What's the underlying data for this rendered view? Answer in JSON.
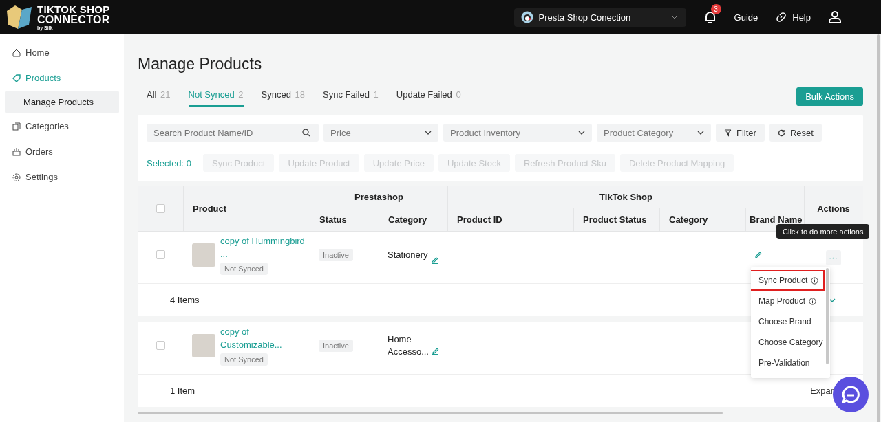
{
  "header": {
    "logo_line1": "TIKTOK SHOP",
    "logo_line2": "CONNECTOR",
    "logo_by": "by Silk",
    "shop_select": "Presta Shop Conection",
    "notifications": "3",
    "guide": "Guide",
    "help": "Help"
  },
  "sidebar": {
    "items": [
      {
        "label": "Home",
        "selected": false
      },
      {
        "label": "Products",
        "selected": true,
        "children": [
          {
            "label": "Manage Products",
            "selected": true
          }
        ]
      },
      {
        "label": "Categories",
        "selected": false
      },
      {
        "label": "Orders",
        "selected": false
      },
      {
        "label": "Settings",
        "selected": false
      }
    ]
  },
  "page": {
    "title": "Manage Products",
    "bulk_actions": "Bulk Actions"
  },
  "tabs": [
    {
      "label": "All",
      "count": "21",
      "selected": false
    },
    {
      "label": "Not Synced",
      "count": "2",
      "selected": true
    },
    {
      "label": "Synced",
      "count": "18",
      "selected": false
    },
    {
      "label": "Sync Failed",
      "count": "1",
      "selected": false
    },
    {
      "label": "Update Failed",
      "count": "0",
      "selected": false
    }
  ],
  "filters": {
    "search": {
      "placeholder": "Search Product Name/ID"
    },
    "selects": [
      {
        "placeholder": "Price"
      },
      {
        "placeholder": "Product Inventory"
      },
      {
        "placeholder": "Product Category"
      }
    ],
    "filter": "Filter",
    "reset": "Reset"
  },
  "bulk": {
    "selected": "Selected: 0",
    "buttons": [
      {
        "label": "Sync Product",
        "disabled": true
      },
      {
        "label": "Update Product",
        "disabled": true
      },
      {
        "label": "Update Price",
        "disabled": true
      },
      {
        "label": "Update Stock",
        "disabled": true
      },
      {
        "label": "Refresh Product Sku",
        "disabled": true
      },
      {
        "label": "Delete Product Mapping",
        "disabled": true
      }
    ]
  },
  "table": {
    "header_checked": false,
    "group_prestashop": "Prestashop",
    "group_tiktok": "TikTok Shop",
    "col_product": "Product",
    "col_actions": "Actions",
    "columns": [
      "Status",
      "Category",
      "Product ID",
      "Product Status",
      "Category",
      "Brand Name"
    ],
    "groups": [
      {
        "rows": [
          {
            "name_line1": "copy of Hummingbird",
            "name_line2": "...",
            "sync_badge": "Not Synced",
            "status": "Inactive",
            "category_line1": "Stationery",
            "checked": false,
            "actions": "···"
          }
        ],
        "footer": "4 Items"
      },
      {
        "rows": [
          {
            "name_line1": "copy of",
            "name_line2": "Customizable...",
            "sync_badge": "Not Synced",
            "status": "Inactive",
            "category_line1": "Home",
            "category_line2": "Accesso...",
            "checked": false
          }
        ],
        "footer": "1 Item",
        "expand": "Expan"
      }
    ]
  },
  "tooltip": "Click to do more actions",
  "menu": [
    {
      "label": "Sync Product",
      "kind": "info",
      "highlighted": true
    },
    {
      "label": "Map Product",
      "kind": "info",
      "highlighted": false
    },
    {
      "label": "Choose Brand",
      "kind": "plain",
      "highlighted": false
    },
    {
      "label": "Choose Category",
      "kind": "plain",
      "highlighted": false
    },
    {
      "label": "Pre-Validation",
      "kind": "plain",
      "highlighted": false
    }
  ]
}
